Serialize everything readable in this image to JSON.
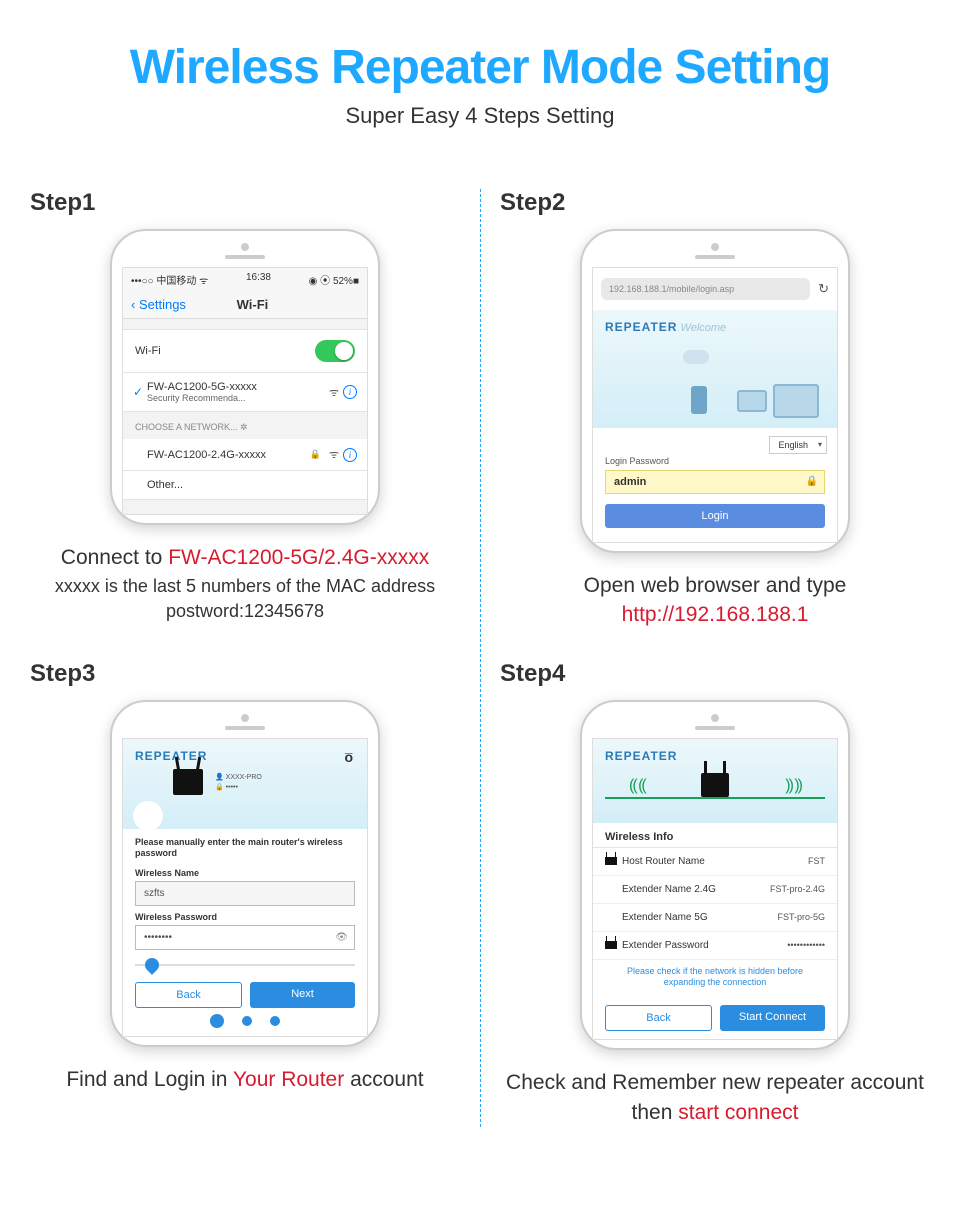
{
  "title": "Wireless Repeater Mode Setting",
  "subtitle": "Super Easy 4 Steps Setting",
  "step1": {
    "label": "Step1",
    "status_left": "•••○○ 中国移动 ᯤ",
    "status_time": "16:38",
    "status_right": "◉ ⦿ 52%■",
    "back": "Settings",
    "nav_title": "Wi-Fi",
    "wifi_label": "Wi-Fi",
    "connected_ssid": "FW-AC1200-5G-xxxxx",
    "connected_sub": "Security Recommenda...",
    "choose_header": "CHOOSE A NETWORK...",
    "network2": "FW-AC1200-2.4G-xxxxx",
    "other": "Other...",
    "caption_pre": "Connect to ",
    "caption_red": "FW-AC1200-5G/2.4G-xxxxx",
    "caption_sub": "xxxxx is the last 5 numbers of the MAC address",
    "caption_pw": "postword:12345678"
  },
  "step2": {
    "label": "Step2",
    "url": "192.168.188.1/mobile/login.asp",
    "rep_title": "REPEATER",
    "welcome": "Welcome",
    "lang": "English",
    "login_label": "Login Password",
    "login_value": "admin",
    "login_btn": "Login",
    "caption_pre": "Open web browser and type",
    "caption_red": "http://192.168.188.1"
  },
  "step3": {
    "label": "Step3",
    "rep_title": "REPEATER",
    "cred_user_label": "XXXX-PRO",
    "cred_pass_label": "•••••",
    "instruction": "Please manually enter the main router's wireless password",
    "name_label": "Wireless Name",
    "name_value": "szfts",
    "pass_label": "Wireless Password",
    "pass_value": "••••••••",
    "back": "Back",
    "next": "Next",
    "caption_pre": "Find and Login in ",
    "caption_red": "Your Router",
    "caption_post": " account"
  },
  "step4": {
    "label": "Step4",
    "rep_title": "REPEATER",
    "info_header": "Wireless Info",
    "row1_k": "Host Router Name",
    "row1_v": "FST",
    "row2_k": "Extender Name 2.4G",
    "row2_v": "FST-pro-2.4G",
    "row3_k": "Extender Name 5G",
    "row3_v": "FST-pro-5G",
    "row4_k": "Extender Password",
    "row4_v": "••••••••••••",
    "note": "Please check if the network is hidden before expanding the connection",
    "back": "Back",
    "start": "Start Connect",
    "caption_pre": "Check and Remember new repeater account then ",
    "caption_red": "start connect"
  }
}
